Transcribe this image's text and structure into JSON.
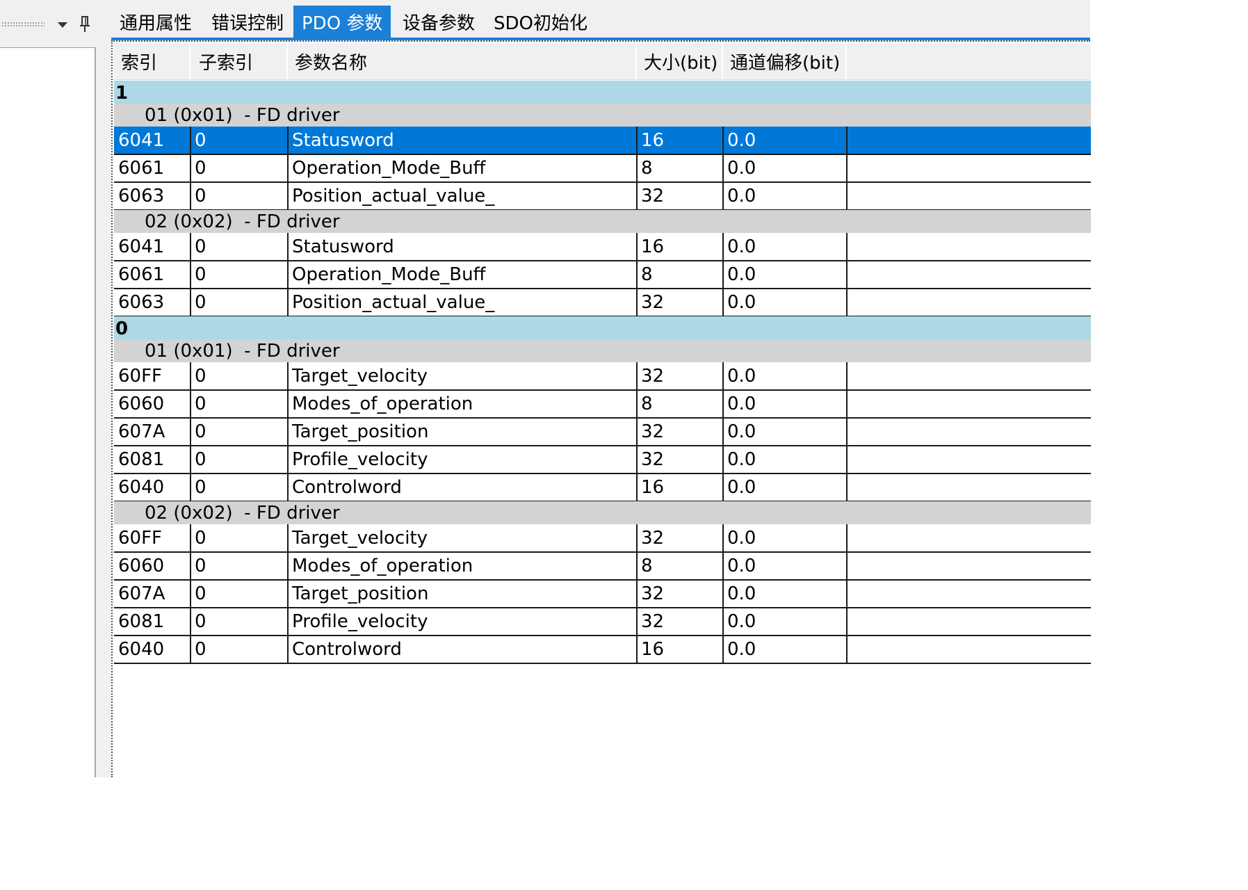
{
  "tabs": [
    {
      "label": "通用属性",
      "active": false
    },
    {
      "label": "错误控制",
      "active": false
    },
    {
      "label": "PDO 参数",
      "active": true
    },
    {
      "label": "设备参数",
      "active": false
    },
    {
      "label": "SDO初始化",
      "active": false
    }
  ],
  "columns": [
    "索引",
    "子索引",
    "参数名称",
    "大小(bit)",
    "通道偏移(bit)"
  ],
  "groups": [
    {
      "label": "1",
      "subgroups": [
        {
          "label": "01 (0x01)  - FD driver",
          "rows": [
            {
              "index": "6041",
              "subindex": "0",
              "name": "Statusword",
              "size": "16",
              "offset": "0.0",
              "selected": true
            },
            {
              "index": "6061",
              "subindex": "0",
              "name": "Operation_Mode_Buff",
              "size": "8",
              "offset": "0.0"
            },
            {
              "index": "6063",
              "subindex": "0",
              "name": "Position_actual_value_",
              "size": "32",
              "offset": "0.0"
            }
          ]
        },
        {
          "label": "02 (0x02)  - FD driver",
          "rows": [
            {
              "index": "6041",
              "subindex": "0",
              "name": "Statusword",
              "size": "16",
              "offset": "0.0"
            },
            {
              "index": "6061",
              "subindex": "0",
              "name": "Operation_Mode_Buff",
              "size": "8",
              "offset": "0.0"
            },
            {
              "index": "6063",
              "subindex": "0",
              "name": "Position_actual_value_",
              "size": "32",
              "offset": "0.0"
            }
          ]
        }
      ]
    },
    {
      "label": "0",
      "subgroups": [
        {
          "label": "01 (0x01)  - FD driver",
          "rows": [
            {
              "index": "60FF",
              "subindex": "0",
              "name": "Target_velocity",
              "size": "32",
              "offset": "0.0"
            },
            {
              "index": "6060",
              "subindex": "0",
              "name": "Modes_of_operation",
              "size": "8",
              "offset": "0.0"
            },
            {
              "index": "607A",
              "subindex": "0",
              "name": "Target_position",
              "size": "32",
              "offset": "0.0"
            },
            {
              "index": "6081",
              "subindex": "0",
              "name": "Profile_velocity",
              "size": "32",
              "offset": "0.0"
            },
            {
              "index": "6040",
              "subindex": "0",
              "name": "Controlword",
              "size": "16",
              "offset": "0.0"
            }
          ]
        },
        {
          "label": "02 (0x02)  - FD driver",
          "rows": [
            {
              "index": "60FF",
              "subindex": "0",
              "name": "Target_velocity",
              "size": "32",
              "offset": "0.0"
            },
            {
              "index": "6060",
              "subindex": "0",
              "name": "Modes_of_operation",
              "size": "8",
              "offset": "0.0"
            },
            {
              "index": "607A",
              "subindex": "0",
              "name": "Target_position",
              "size": "32",
              "offset": "0.0"
            },
            {
              "index": "6081",
              "subindex": "0",
              "name": "Profile_velocity",
              "size": "32",
              "offset": "0.0"
            },
            {
              "index": "6040",
              "subindex": "0",
              "name": "Controlword",
              "size": "16",
              "offset": "0.0"
            }
          ]
        }
      ]
    }
  ],
  "icons": {
    "left_dropdown": "chevron-down-icon",
    "left_pin": "pin-icon"
  },
  "colors": {
    "accent": "#1a80d8",
    "selection": "#0078d7",
    "group_row": "#add8e6",
    "subgroup_row": "#d3d3d3"
  }
}
